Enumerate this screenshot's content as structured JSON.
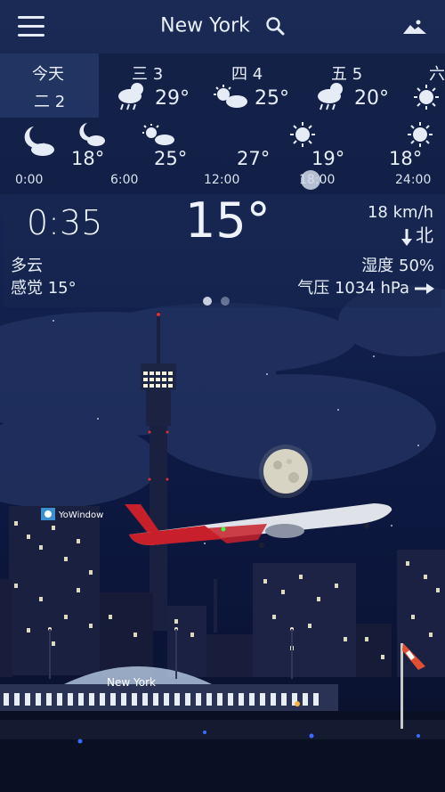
{
  "app": {
    "city": "New York",
    "brand": "YoWindow"
  },
  "days": [
    {
      "name": "今天",
      "sub": "二 2",
      "icon": "none",
      "temp": ""
    },
    {
      "name": "三 3",
      "icon": "rain-cloud-sun-icon",
      "temp": "29°"
    },
    {
      "name": "四 4",
      "icon": "sun-cloud-icon",
      "temp": "25°"
    },
    {
      "name": "五 5",
      "icon": "rain-cloud-sun-icon",
      "temp": "20°"
    },
    {
      "name": "六",
      "icon": "sun-icon",
      "temp": ""
    }
  ],
  "hourly": {
    "temps": [
      {
        "icon": "moon-cloud-icon",
        "temp": ""
      },
      {
        "icon": "moon-cloud-icon",
        "temp": "18°"
      },
      {
        "icon": "sun-cloud-icon",
        "temp": "25°"
      },
      {
        "icon": "none",
        "temp": "27°"
      },
      {
        "icon": "sun-icon",
        "temp": "19°"
      },
      {
        "icon": "sun-icon",
        "temp": "18°"
      }
    ],
    "ticks": [
      "0:00",
      "6:00",
      "12:00",
      "18:00",
      "24:00"
    ],
    "knob_position_hours": 18
  },
  "current": {
    "time": "0:35",
    "temperature": "15°",
    "wind_speed": "18 km/h",
    "wind_direction": "北",
    "condition": "多云",
    "feels_like": "感觉 15°",
    "humidity": "湿度 50%",
    "pressure": "气压 1034 hPa"
  },
  "pager": {
    "pages": 2,
    "active": 0
  },
  "scene": {
    "airport_sign": "New York",
    "colors": {
      "sky_top": "#1a2a55",
      "sky_bottom": "#081028",
      "plane_red": "#c8202a",
      "moon": "#d8d4c4"
    }
  }
}
